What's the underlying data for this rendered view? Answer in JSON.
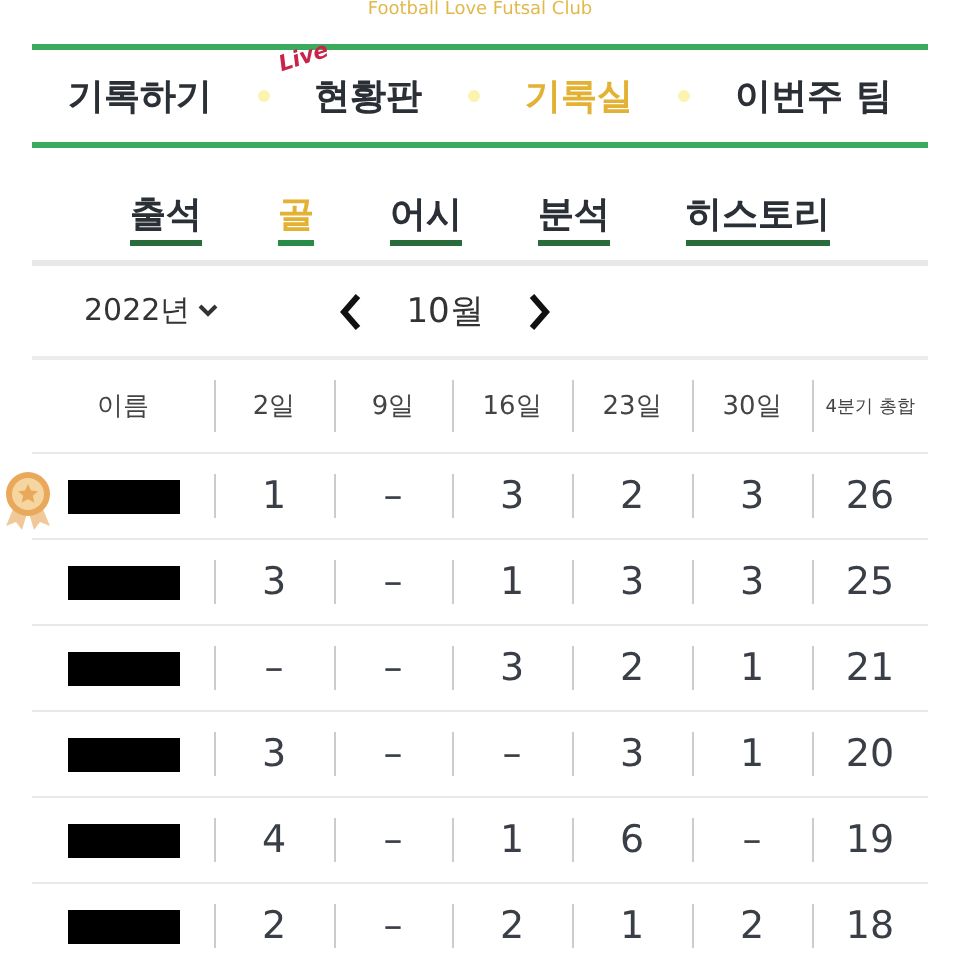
{
  "club_name": "Football Love Futsal Club",
  "nav": [
    {
      "label": "기록하기",
      "selected": false
    },
    {
      "label": "현황판",
      "selected": false,
      "badge": "Live"
    },
    {
      "label": "기록실",
      "selected": true
    },
    {
      "label": "이번주 팀",
      "selected": false
    }
  ],
  "subtabs": [
    {
      "label": "출석",
      "selected": false
    },
    {
      "label": "골",
      "selected": true
    },
    {
      "label": "어시",
      "selected": false
    },
    {
      "label": "분석",
      "selected": false
    },
    {
      "label": "히스토리",
      "selected": false
    }
  ],
  "year": "2022년",
  "month": "10월",
  "table": {
    "name_header": "이름",
    "columns": [
      "2일",
      "9일",
      "16일",
      "23일",
      "30일",
      "4분기 총합"
    ],
    "rows": [
      {
        "medal": true,
        "cells": [
          "1",
          "–",
          "3",
          "2",
          "3",
          "26"
        ]
      },
      {
        "medal": false,
        "cells": [
          "3",
          "–",
          "1",
          "3",
          "3",
          "25"
        ]
      },
      {
        "medal": false,
        "cells": [
          "–",
          "–",
          "3",
          "2",
          "1",
          "21"
        ]
      },
      {
        "medal": false,
        "cells": [
          "3",
          "–",
          "–",
          "3",
          "1",
          "20"
        ]
      },
      {
        "medal": false,
        "cells": [
          "4",
          "–",
          "1",
          "6",
          "–",
          "19"
        ]
      },
      {
        "medal": false,
        "cells": [
          "2",
          "–",
          "2",
          "1",
          "2",
          "18"
        ]
      }
    ]
  }
}
